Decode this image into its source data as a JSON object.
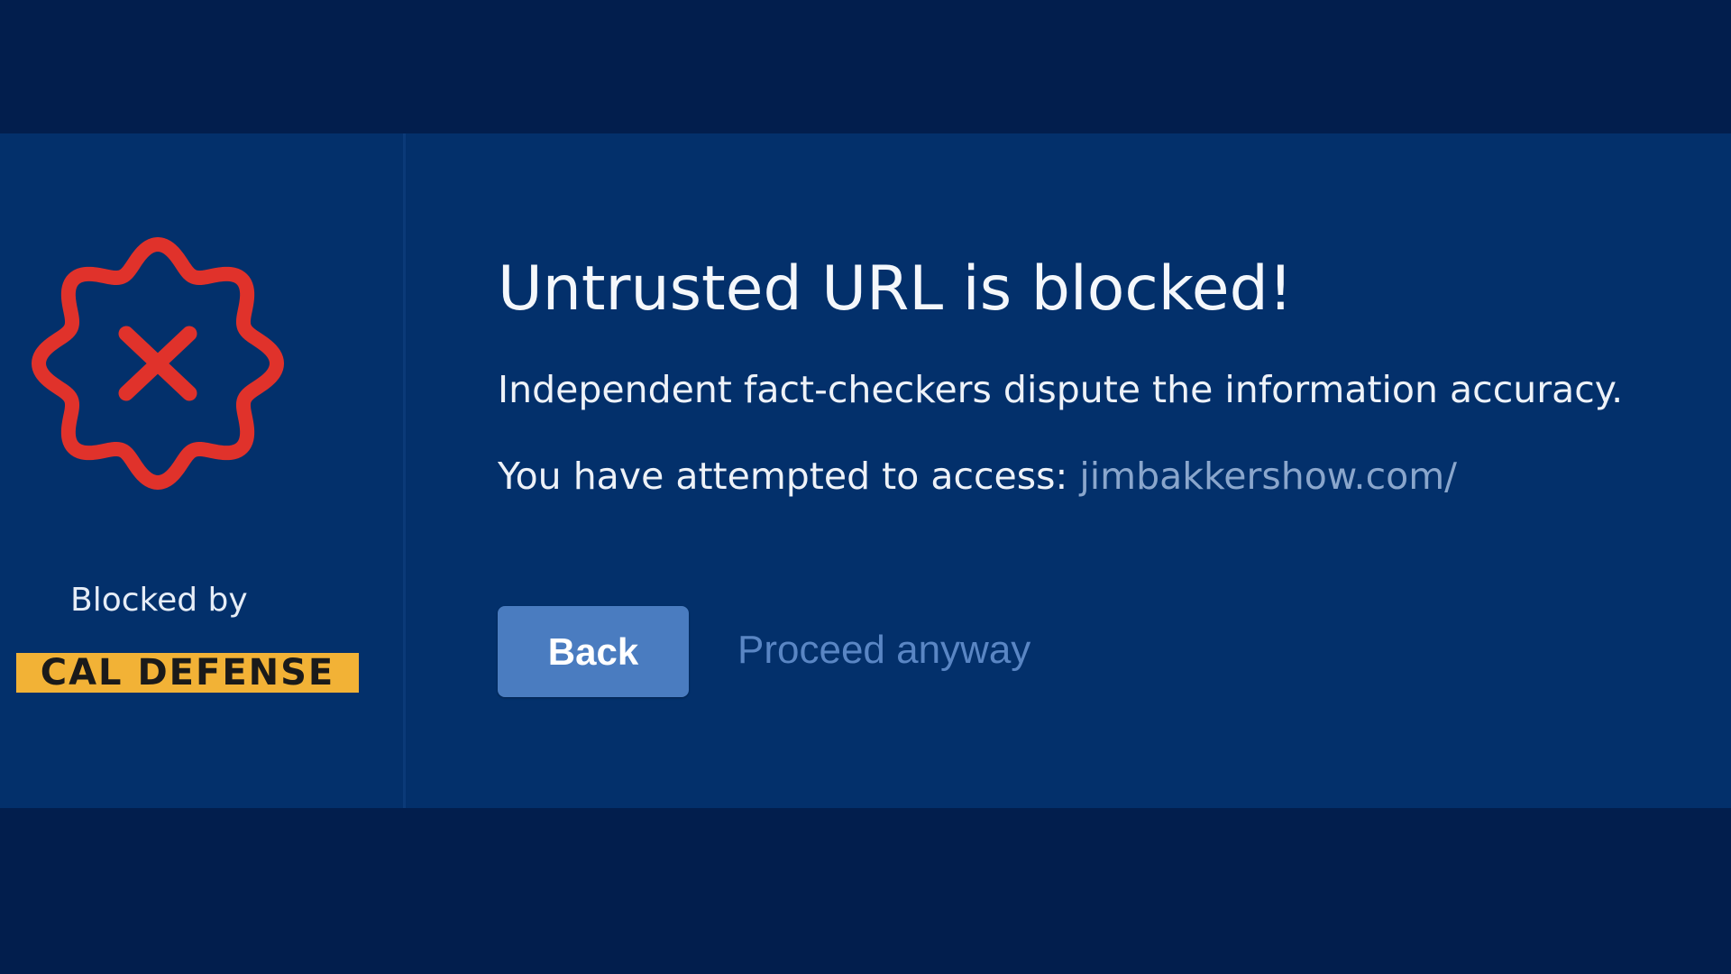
{
  "colors": {
    "page_background": "#021e4d",
    "panel_background": "#03306b",
    "badge_red": "#e0322b",
    "brand_yellow": "#f2b236",
    "button_blue": "#4a7cc0",
    "link_blue": "#5a86c4",
    "url_gray": "#8aa6cc"
  },
  "sidebar": {
    "icon": "blocked-badge-x-icon",
    "blocked_by_label": "Blocked by",
    "brand_name": "CAL DEFENSE"
  },
  "main": {
    "title": "Untrusted URL is blocked!",
    "message": "Independent fact-checkers dispute the information accuracy.",
    "access_prefix": "You have attempted to access:",
    "blocked_url": "jimbakkershow.com/",
    "back_label": "Back",
    "proceed_label": "Proceed anyway"
  }
}
